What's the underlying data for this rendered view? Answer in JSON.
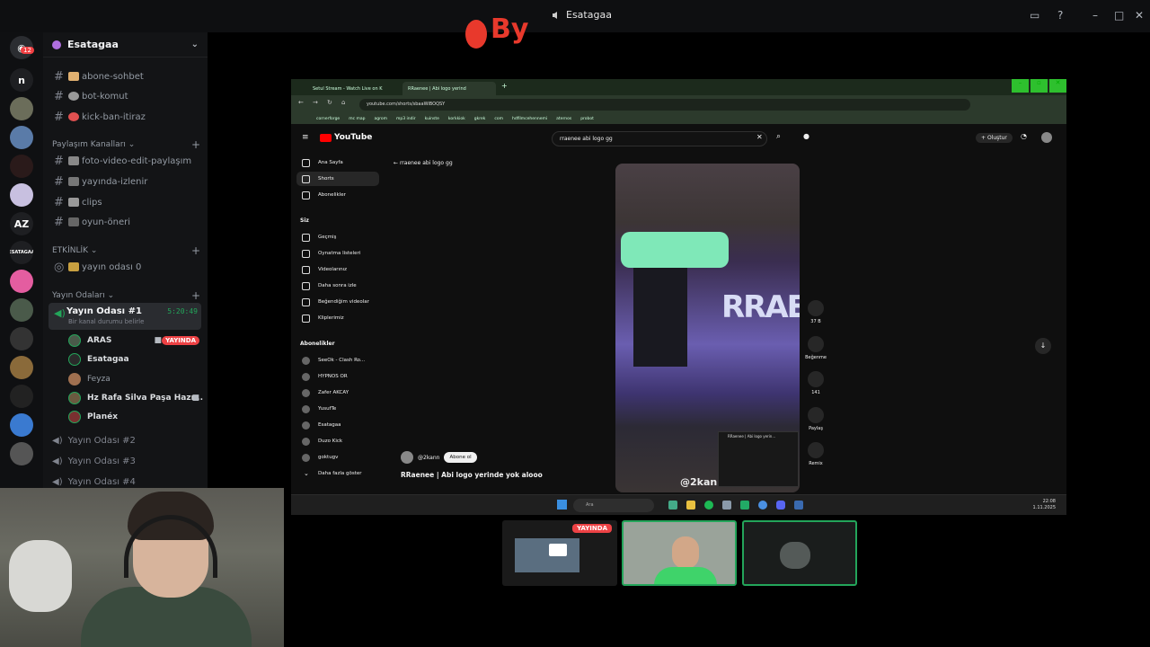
{
  "stream_window": {
    "title": "Esatagaa"
  },
  "server_rail": {
    "mention_badge": "12",
    "letter_icons": [
      "n",
      "AZ"
    ],
    "small_text_icon": "ESATAGAA"
  },
  "server": {
    "name": "Esatagaa"
  },
  "channels": [
    {
      "name": "abone-sohbet"
    },
    {
      "name": "bot-komut"
    },
    {
      "name": "kick-ban-itiraz"
    }
  ],
  "categories": {
    "sharing": "Paylaşım Kanalları",
    "events": "ETKİNLİK",
    "stream_rooms": "Yayın Odaları"
  },
  "sharing_channels": [
    {
      "name": "foto-video-edit-paylaşım"
    },
    {
      "name": "yayında-izlenir"
    },
    {
      "name": "clips"
    },
    {
      "name": "oyun-öneri"
    }
  ],
  "event_channel": {
    "name": "yayın odası 0"
  },
  "active_voice": {
    "name": "Yayın Odası #1",
    "timer": "5:20:49",
    "status": "Bir kanal durumu belirle"
  },
  "voice_users": [
    {
      "name": "ARAS",
      "live": "YAYINDA"
    },
    {
      "name": "Esatagaa"
    },
    {
      "name": "Feyza"
    },
    {
      "name": "Hz Rafa Silva Paşa Hazr..."
    },
    {
      "name": "Planéx"
    }
  ],
  "other_voice": [
    "Yayın Odası #2",
    "Yayın Odası #3",
    "Yayın Odası #4"
  ],
  "browser": {
    "tabs": [
      "Setul Stream - Watch Live on K",
      "RRaenee | Abi logo yerind"
    ],
    "url": "youtube.com/shorts/sbaaWiBOQSY",
    "bookmarks": [
      "cornerforge",
      "mc map",
      "agrom",
      "mp3 indir",
      "kuinste",
      "korkkiok",
      "gkrek",
      "com",
      "hdfilmcehennemi",
      "aternos",
      "probot"
    ]
  },
  "youtube": {
    "logo": "YouTube",
    "search_query": "rraenee abi logo gg",
    "create_label": "Oluştur",
    "breadcrumb": "rraenee abi logo gg",
    "nav": [
      "Ana Sayfa",
      "Shorts",
      "Abonelikler"
    ],
    "you_section": "Siz",
    "you_items": [
      "Geçmiş",
      "Oynatma listeleri",
      "Videolarınız",
      "Daha sonra izle",
      "Beğendiğim videolar",
      "Kliplerimiz"
    ],
    "subs_section": "Abonelikler",
    "subs": [
      "SeeOk - Clash Ro...",
      "HYPNOS OR",
      "Zafer AKCAY",
      "YusufTe",
      "Esatagaa",
      "Duzo Kick",
      "goktugv"
    ],
    "show_more": "Daha fazla göster",
    "channel_handle": "@2kann",
    "subscribe": "Abone ol",
    "caption": "RRaenee | Abi logo yerinde yok alooo",
    "likes": "37 B",
    "dislike_label": "Beğenme",
    "comments": "141",
    "share_label": "Paylaş",
    "remix_label": "Remix",
    "video_watermark": "@2kan",
    "video_wordmark": "RRAEN",
    "miniplayer_title": "RRaenee | Abi logo yerin..."
  },
  "taskbar": {
    "search_placeholder": "Ara",
    "time": "22:08",
    "date": "1.11.2025"
  },
  "thumbnails": {
    "live_label": "YAYINDA"
  },
  "colors": {
    "discord_green": "#23a55a",
    "live_red": "#ed4245",
    "youtube_red": "#ff0000"
  }
}
